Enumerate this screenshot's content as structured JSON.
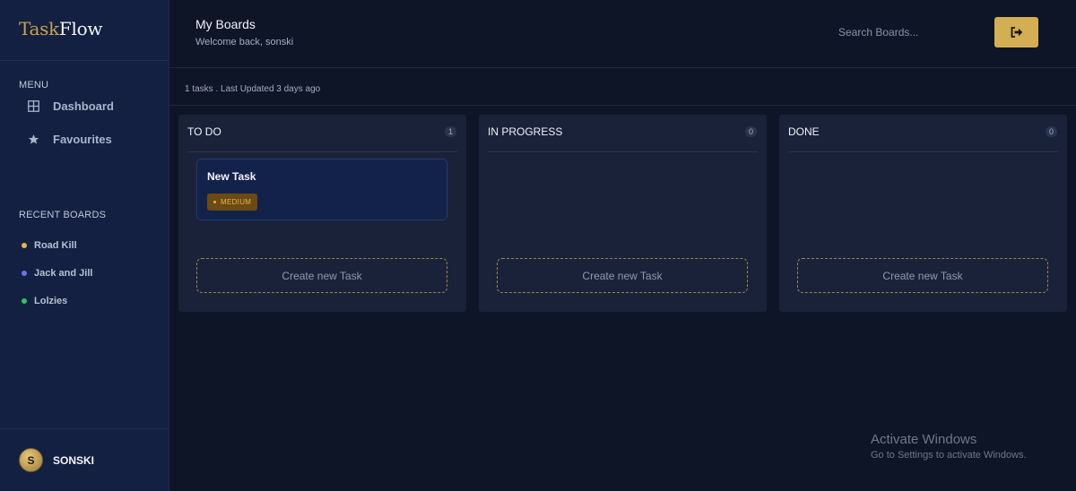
{
  "app": {
    "logo_part1": "Task",
    "logo_part2": "Flow"
  },
  "sidebar": {
    "menu_label": "MENU",
    "nav": [
      {
        "label": "Dashboard",
        "icon": "grid-icon"
      },
      {
        "label": "Favourites",
        "icon": "star-icon"
      }
    ],
    "recent_label": "RECENT BOARDS",
    "recent": [
      {
        "label": "Road Kill",
        "color": "#e3b54b"
      },
      {
        "label": "Jack and Jill",
        "color": "#6d6ff0"
      },
      {
        "label": "Lolzies",
        "color": "#31c45e"
      }
    ],
    "user": {
      "initial": "S",
      "name": "SONSKI"
    }
  },
  "header": {
    "title": "My Boards",
    "subtitle": "Welcome back, sonski",
    "search_placeholder": "Search Boards...",
    "logout_icon": "logout-icon"
  },
  "meta": {
    "text": "1 tasks . Last Updated 3 days ago"
  },
  "columns": [
    {
      "title": "TO DO",
      "count": "1",
      "tasks": [
        {
          "title": "New Task",
          "priority": "MEDIUM"
        }
      ],
      "create_label": "Create new Task"
    },
    {
      "title": "IN PROGRESS",
      "count": "0",
      "tasks": [],
      "create_label": "Create new Task"
    },
    {
      "title": "DONE",
      "count": "0",
      "tasks": [],
      "create_label": "Create new Task"
    }
  ],
  "watermark": {
    "title": "Activate Windows",
    "subtitle": "Go to Settings to activate Windows."
  },
  "colors": {
    "accent": "#d4ae52",
    "background": "#0d1526",
    "sidebar": "#132041",
    "column": "#1a2239"
  }
}
